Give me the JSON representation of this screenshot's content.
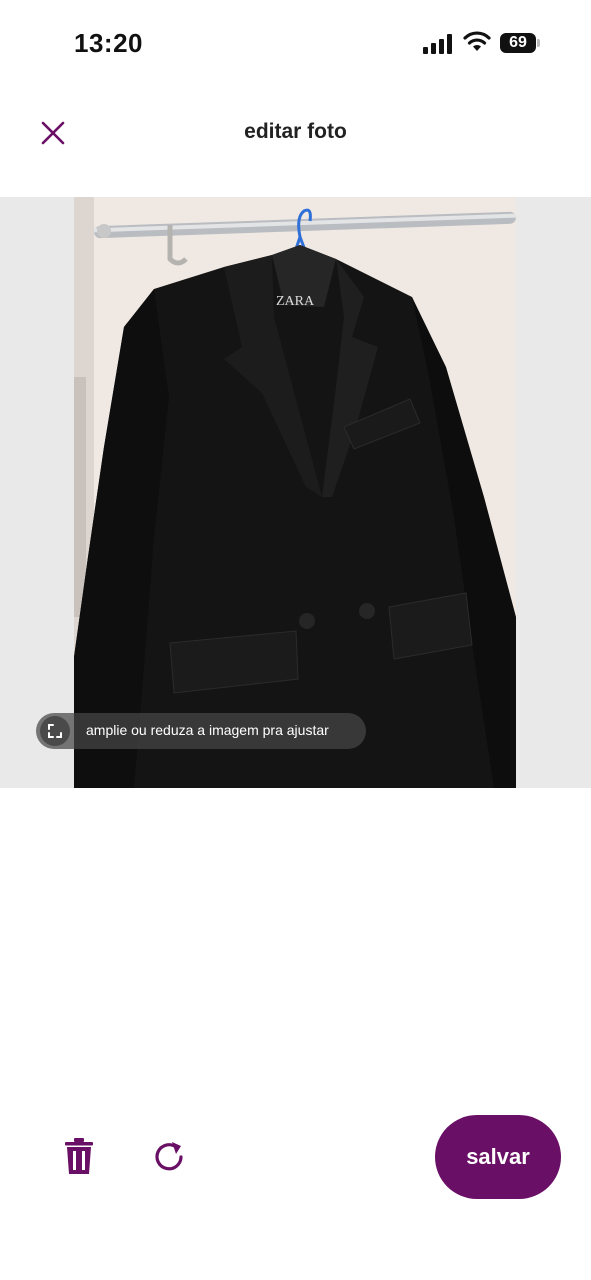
{
  "status_bar": {
    "time": "13:20",
    "battery_level": "69",
    "icons": [
      "signal-icon",
      "wifi-icon",
      "battery-icon"
    ]
  },
  "header": {
    "title": "editar foto",
    "close_icon": "close-icon"
  },
  "photo": {
    "brand_label": "ZARA",
    "hint": "amplie ou reduza a imagem pra ajustar",
    "hint_icon": "resize-icon"
  },
  "toolbar": {
    "delete_icon": "trash-icon",
    "rotate_icon": "rotate-icon",
    "save_label": "salvar"
  },
  "colors": {
    "accent": "#6a0f66",
    "background": "#ffffff",
    "crop_background": "#e9e9e9"
  }
}
